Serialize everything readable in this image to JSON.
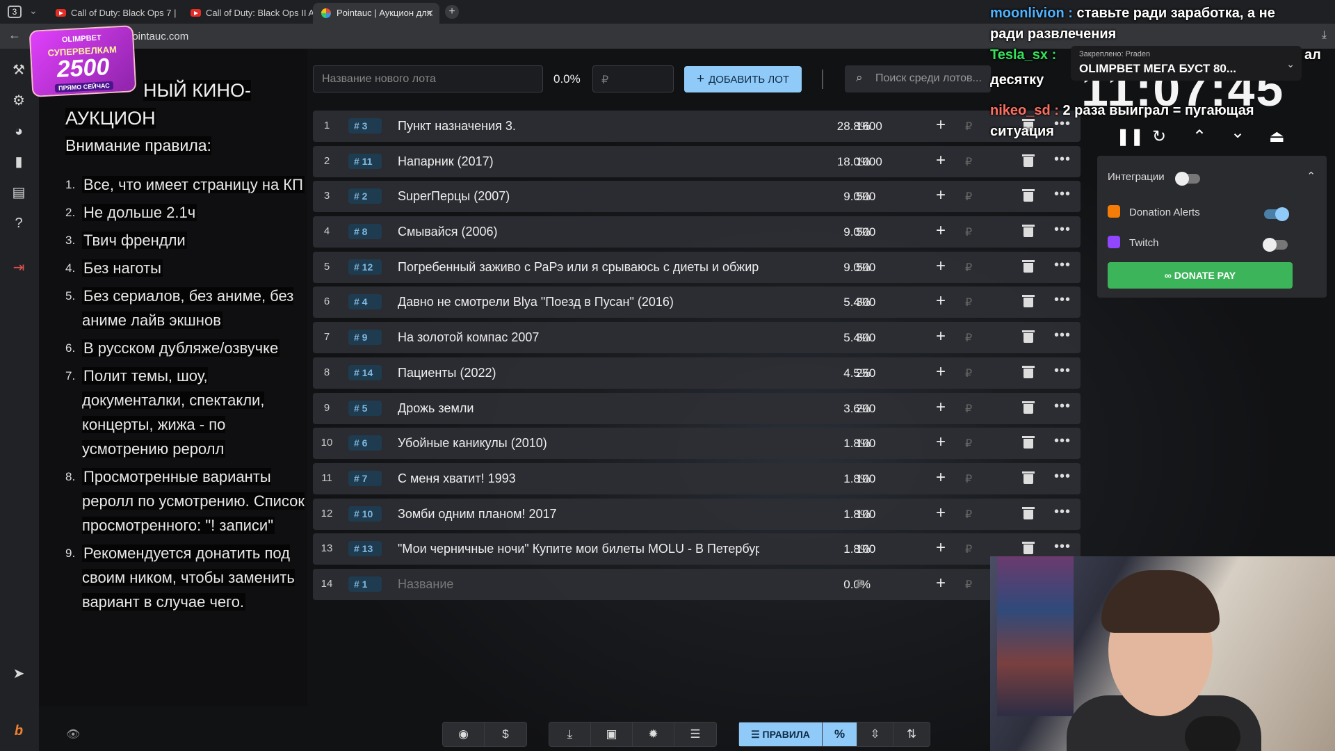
{
  "browser": {
    "tab_count": "3",
    "tabs": [
      {
        "label": "Call of Duty: Black Ops 7 |"
      },
      {
        "label": "Call of Duty: Black Ops II A"
      },
      {
        "label": "Pointauc | Аукцион для"
      }
    ],
    "url": "pointauc.com"
  },
  "promo": {
    "brand": "OLIMPBET",
    "line": "СУПЕРВЕЛКАМ",
    "amount": "2500",
    "cta": "ПРЯМО СЕЙЧАС"
  },
  "rules": {
    "title_rest": "НЫЙ КИНО-",
    "title_line2": "АУКЦИОН",
    "subtitle": "Внимание правила:",
    "items": [
      {
        "num": "1.",
        "text": "Все, что имеет страницу на КП"
      },
      {
        "num": "2.",
        "text": "Не дольше 2.1ч"
      },
      {
        "num": "3.",
        "text": "Твич френдли"
      },
      {
        "num": "4.",
        "text": "Без наготы"
      },
      {
        "num": "5.",
        "text": "Без сериалов, без аниме, без аниме лайв экшнов"
      },
      {
        "num": "6.",
        "text": "В русском дубляже/озвучке"
      },
      {
        "num": "7.",
        "text": "Полит темы, шоу, документалки, спектакли, концерты, жижа - по усмотрению реролл"
      },
      {
        "num": "8.",
        "text": "Просмотренные варианты реролл по усмотрению. Список просмотренного: \"! записи\""
      },
      {
        "num": "9.",
        "text": "Рекомендуется донатить под своим ником, чтобы заменить вариант в случае чего."
      }
    ]
  },
  "topbar": {
    "lot_placeholder": "Название нового лота",
    "percent": "0.0%",
    "amount_placeholder": "₽",
    "add_label": "ДОБАВИТЬ ЛОТ",
    "search_placeholder": "Поиск среди лотов..."
  },
  "lots": [
    {
      "idx": "1",
      "tag": "# 3",
      "name": "Пункт назначения 3.",
      "pct": "28.8%",
      "amt": "1600"
    },
    {
      "idx": "2",
      "tag": "# 11",
      "name": "Напарник (2017)",
      "pct": "18.0%",
      "amt": "1000"
    },
    {
      "idx": "3",
      "tag": "# 2",
      "name": "SuperПерцы (2007)",
      "pct": "9.0%",
      "amt": "500"
    },
    {
      "idx": "4",
      "tag": "# 8",
      "name": "Смывайся (2006)",
      "pct": "9.0%",
      "amt": "500"
    },
    {
      "idx": "5",
      "tag": "# 12",
      "name": "Погребенный заживо с РаРэ или я срываюсь с диеты и обжирак",
      "pct": "9.0%",
      "amt": "500"
    },
    {
      "idx": "6",
      "tag": "# 4",
      "name": "Давно не смотрели Blya \"Поезд в Пусан\" (2016)",
      "pct": "5.4%",
      "amt": "300"
    },
    {
      "idx": "7",
      "tag": "# 9",
      "name": "На золотой компас 2007",
      "pct": "5.4%",
      "amt": "300"
    },
    {
      "idx": "8",
      "tag": "# 14",
      "name": "Пациенты (2022)",
      "pct": "4.5%",
      "amt": "250"
    },
    {
      "idx": "9",
      "tag": "# 5",
      "name": "Дрожь земли",
      "pct": "3.6%",
      "amt": "200"
    },
    {
      "idx": "10",
      "tag": "# 6",
      "name": "Убойные каникулы (2010)",
      "pct": "1.8%",
      "amt": "100"
    },
    {
      "idx": "11",
      "tag": "# 7",
      "name": "С меня хватит! 1993",
      "pct": "1.8%",
      "amt": "100"
    },
    {
      "idx": "12",
      "tag": "# 10",
      "name": "Зомби одним планом! 2017",
      "pct": "1.8%",
      "amt": "100"
    },
    {
      "idx": "13",
      "tag": "# 13",
      "name": "\"Мои черничные ночи\" Купите мои билеты MOLU - В Петербург",
      "pct": "1.8%",
      "amt": "100"
    },
    {
      "idx": "14",
      "tag": "# 1",
      "name": "Название",
      "pct": "0.0%",
      "amt": "₽",
      "placeholder": true
    }
  ],
  "row_currency": "₽",
  "toolbar": {
    "rules_label": "ПРАВИЛА",
    "percent_label": "%"
  },
  "timer": {
    "value": "11:07:45"
  },
  "integrations": {
    "header": "Интеграции",
    "donation_alerts": "Donation Alerts",
    "twitch": "Twitch",
    "donate_pay": "DONATE PAY",
    "donation_alerts_color": "#f57d07",
    "twitch_color": "#9146ff"
  },
  "chat": {
    "msg1_nick": "moonlivion :",
    "msg1_text": "ставьте ради заработка, а не",
    "msg1_text2": "ради развлечения",
    "msg2_nick": "Tesla_sx :",
    "msg2_text": "десятку",
    "msg3_nick": "nikeo_sd :",
    "msg3_text": "2 раза выиграл = пугающая",
    "msg3_text2": "ситуация",
    "cut_text": "ал",
    "pinned_label": "Закреплено: Praden",
    "pinned_text": "OLIMPBET МЕГА БУСТ 80..."
  }
}
